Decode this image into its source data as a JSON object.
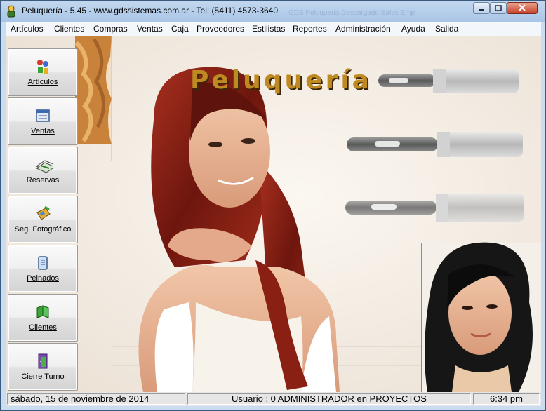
{
  "window": {
    "title": "Peluquería -  5.45 - www.gdssistemas.com.ar - Tel: (5411) 4573-3640",
    "background_tabs": "GDS Peluqueria   Descargado   Sales   Emp"
  },
  "menu": [
    "Artículos",
    "Clientes",
    "Compras",
    "Ventas",
    "Caja",
    "Proveedores",
    "Estilistas",
    "Reportes",
    "Administración",
    "Ayuda",
    "Salida"
  ],
  "sidebar": {
    "items": [
      {
        "label": "Artículos",
        "icon": "articles-icon"
      },
      {
        "label": "Ventas",
        "icon": "sales-icon"
      },
      {
        "label": "Reservas",
        "icon": "reservations-icon"
      },
      {
        "label": "Seg. Fotográfico",
        "icon": "photo-tracking-icon"
      },
      {
        "label": "Peinados",
        "icon": "hairstyles-icon"
      },
      {
        "label": "Clientes",
        "icon": "clients-icon"
      },
      {
        "label": "Cierre Turno",
        "icon": "close-shift-icon"
      }
    ]
  },
  "banner": {
    "title": "Peluquería"
  },
  "status": {
    "date": "sábado, 15 de noviembre de 2014",
    "user": "Usuario : 0 ADMINISTRADOR en PROYECTOS",
    "time": "6:34 pm"
  },
  "colors": {
    "accent_gold": "#c08a22",
    "hair_red": "#7a1a12",
    "background": "#f3ede5"
  }
}
